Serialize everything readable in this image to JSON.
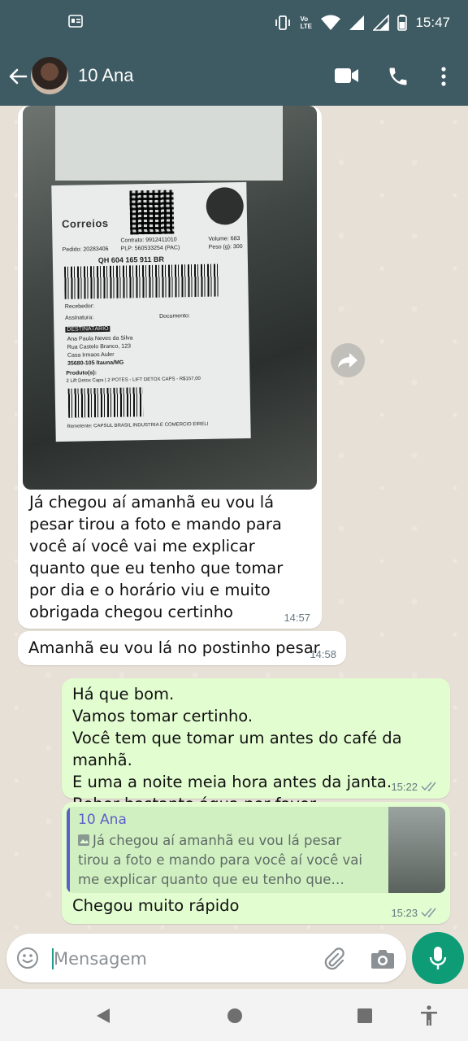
{
  "status_bar": {
    "time": "15:47",
    "network_label": "Vo LTE"
  },
  "contact": {
    "name": "10 Ana"
  },
  "messages": [
    {
      "type": "incoming-photo",
      "photo_text": {
        "logo": "Correios",
        "contrato": "Contrato: 9912411010",
        "volume": "Volume: 683",
        "pedido": "Pedido: 20283406",
        "plp": "PLP: 560533254 (PAC)",
        "peso": "Peso (g): 300",
        "tracking": "QH 604 165 911 BR",
        "recebedor": "Recebedor:",
        "assinatura": "Assinatura:",
        "documento": "Documento:",
        "destinatario": "DESTINATÁRIO",
        "dest_name": "Ana Paula Neves da Silva",
        "dest_street": "Rua Castelo Branco, 123",
        "dest_place": "Casa Irmaos Auler",
        "dest_city": "35680-105 Itauna/MG",
        "produtos": "Produto(s):",
        "produtos_desc": "2 Lift Detox Caps | 2 POTES - LIFT DETOX CAPS - R$157,00",
        "remetente": "Remetente: CAPSUL BRASIL INDUSTRIA E COMERCIO EIRELI"
      },
      "text": "Já chegou aí amanhã eu vou lá pesar tirou a foto e mando para você aí você vai me explicar quanto que eu tenho que tomar por dia e o horário viu e muito obrigada chegou certinho",
      "time": "14:57"
    },
    {
      "type": "incoming",
      "text": "Amanhã eu vou lá no postinho pesar",
      "time": "14:58"
    },
    {
      "type": "outgoing",
      "lines": [
        "Há que bom.",
        "Vamos tomar certinho.",
        "Você tem que tomar um antes do café da manhã.",
        "E uma a noite meia hora antes da janta. Beber bastante água por favor."
      ],
      "time": "15:22"
    },
    {
      "type": "outgoing-reply",
      "quote_name": "10 Ana",
      "quote_text": "Já chegou aí amanhã eu vou lá pesar tirou a foto e mando para você aí você vai me explicar quanto que eu tenho que tomar por dia e o horário viu e muito obrigada chegou certinho",
      "text": "Chegou muito rápido",
      "time": "15:23"
    }
  ],
  "composer": {
    "placeholder": "Mensagem"
  },
  "colors": {
    "header": "#3e5a63",
    "outgoing_bubble": "#e2fdd0",
    "accent": "#0d9c76",
    "read_ticks": "#53bdeb"
  }
}
